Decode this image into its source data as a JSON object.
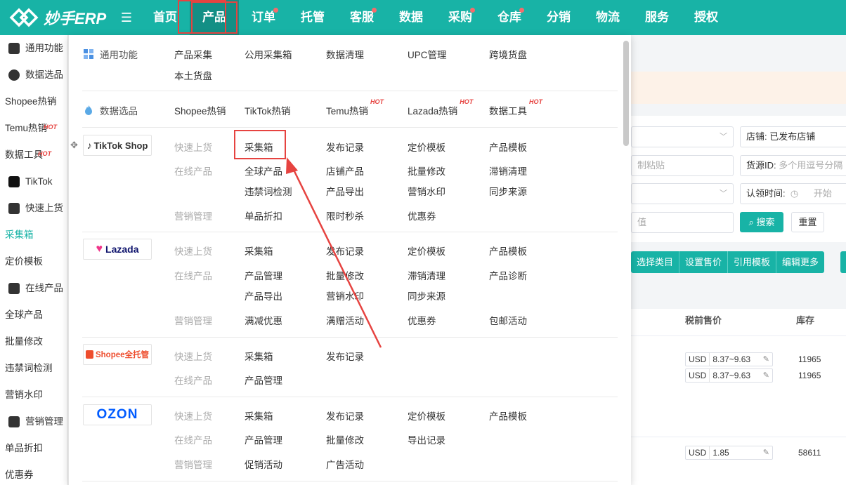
{
  "app": {
    "logo_text": "妙手ERP"
  },
  "nav": [
    {
      "label": "首页",
      "dot": false
    },
    {
      "label": "产品",
      "dot": false,
      "active": true
    },
    {
      "label": "订单",
      "dot": true
    },
    {
      "label": "托管",
      "dot": false
    },
    {
      "label": "客服",
      "dot": true
    },
    {
      "label": "数据",
      "dot": false
    },
    {
      "label": "采购",
      "dot": true
    },
    {
      "label": "仓库",
      "dot": true
    },
    {
      "label": "分销",
      "dot": false
    },
    {
      "label": "物流",
      "dot": false
    },
    {
      "label": "服务",
      "dot": false
    },
    {
      "label": "授权",
      "dot": false
    }
  ],
  "sidebar": {
    "items": [
      {
        "label": "通用功能"
      },
      {
        "label": "数据选品"
      },
      {
        "label": "Shopee热销"
      },
      {
        "label": "Temu热销",
        "hot": "HOT"
      },
      {
        "label": "数据工具",
        "hot": "HOT"
      },
      {
        "label": "TikTok"
      },
      {
        "label": "快速上货"
      },
      {
        "label": "采集箱"
      },
      {
        "label": "定价模板"
      },
      {
        "label": "在线产品"
      },
      {
        "label": "全球产品"
      },
      {
        "label": "批量修改"
      },
      {
        "label": "违禁词检测"
      },
      {
        "label": "营销水印"
      },
      {
        "label": "营销管理"
      },
      {
        "label": "单品折扣"
      },
      {
        "label": "优惠券"
      }
    ]
  },
  "dropdown": {
    "general": {
      "label": "通用功能",
      "links": [
        "产品采集",
        "公用采集箱",
        "数据清理",
        "UPC管理",
        "跨境货盘",
        "本土货盘"
      ]
    },
    "data_selection": {
      "label": "数据选品",
      "links": [
        {
          "label": "Shopee热销",
          "hot": ""
        },
        {
          "label": "TikTok热销",
          "hot": ""
        },
        {
          "label": "Temu热销",
          "hot": "HOT"
        },
        {
          "label": "Lazada热销",
          "hot": "HOT"
        },
        {
          "label": "数据工具",
          "hot": "HOT"
        }
      ]
    },
    "tiktok": {
      "brand": "TikTok Shop",
      "sub_quick": "快速上货",
      "sub_online": "在线产品",
      "sub_marketing": "营销管理",
      "quick": [
        "采集箱",
        "发布记录",
        "定价模板",
        "产品模板"
      ],
      "online_row1": [
        "全球产品",
        "店铺产品",
        "批量修改",
        "滞销清理"
      ],
      "online_row2": [
        "违禁词检测",
        "产品导出",
        "营销水印",
        "同步来源"
      ],
      "marketing": [
        "单品折扣",
        "限时秒杀",
        "优惠券"
      ]
    },
    "lazada": {
      "brand": "Lazada",
      "sub_quick": "快速上货",
      "sub_online": "在线产品",
      "sub_marketing": "营销管理",
      "quick": [
        "采集箱",
        "发布记录",
        "定价模板",
        "产品模板"
      ],
      "online_row1": [
        "产品管理",
        "批量修改",
        "滞销清理",
        "产品诊断"
      ],
      "online_row2": [
        "产品导出",
        "营销水印",
        "同步来源"
      ],
      "marketing": [
        "满减优惠",
        "满赠活动",
        "优惠券",
        "包邮活动"
      ]
    },
    "shopee": {
      "brand": "Shopee全托管",
      "sub_quick": "快速上货",
      "sub_online": "在线产品",
      "quick": [
        "采集箱",
        "发布记录"
      ],
      "online": [
        "产品管理"
      ]
    },
    "ozon": {
      "brand": "OZON",
      "sub_quick": "快速上货",
      "sub_online": "在线产品",
      "sub_marketing": "营销管理",
      "quick": [
        "采集箱",
        "发布记录",
        "定价模板",
        "产品模板"
      ],
      "online": [
        "产品管理",
        "批量修改",
        "导出记录"
      ],
      "marketing": [
        "促销活动",
        "广告活动"
      ]
    }
  },
  "background": {
    "store_label": "店铺:",
    "store_value": "已发布店铺",
    "paste_placeholder": "制粘贴",
    "source_id_label": "货源ID:",
    "source_id_placeholder": "多个用逗号分隔",
    "claim_time_label": "认领时间:",
    "claim_time_start": "开始",
    "value_placeholder": "值",
    "search_button": "搜索",
    "reset_button": "重置",
    "actions": [
      "选择类目",
      "设置售价",
      "引用模板",
      "编辑更多"
    ],
    "col_price": "税前售价",
    "col_stock": "库存",
    "rows": [
      {
        "currency": "USD",
        "price": "8.37~9.63",
        "stock": "11965"
      },
      {
        "currency": "USD",
        "price": "8.37~9.63",
        "stock": "11965"
      },
      {
        "currency": "USD",
        "price": "1.85",
        "stock": "58611"
      }
    ]
  },
  "colors": {
    "brand": "#18b3a6",
    "highlight": "#e64340",
    "hot": "#e64340"
  }
}
